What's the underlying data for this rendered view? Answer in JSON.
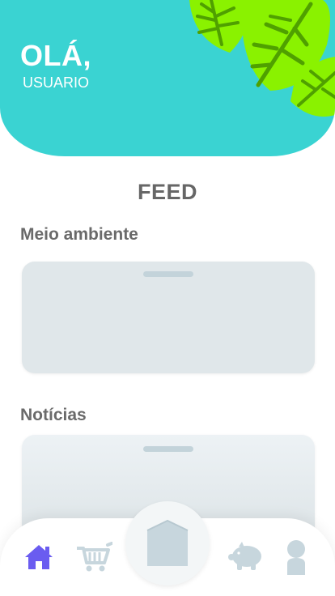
{
  "header": {
    "greeting": "OLÁ,",
    "username": "USUARIO"
  },
  "feed": {
    "title": "FEED",
    "sections": [
      {
        "title": "Meio ambiente"
      },
      {
        "title": "Notícias"
      }
    ]
  },
  "colors": {
    "header_bg": "#3ad3d2",
    "leaf_green": "#8af200",
    "nav_active": "#6a5cf0",
    "nav_inactive": "#c7d6dd"
  },
  "nav": {
    "items": [
      "home-icon",
      "shopping-cart-icon",
      "center-house-icon",
      "piggy-bank-icon",
      "user-icon"
    ]
  }
}
